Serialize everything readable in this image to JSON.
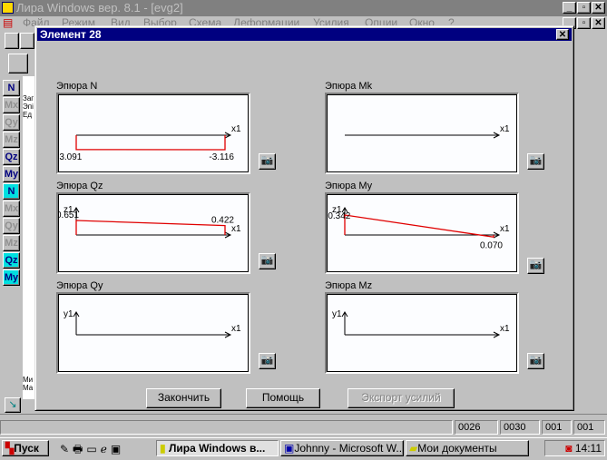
{
  "app": {
    "title": "Лира Windows  вер. 8.1 - [evg2]",
    "menu": [
      "Файл",
      "Режим",
      "Вид",
      "Выбор",
      "Схема",
      "Деформации",
      "Усилия",
      "Опции",
      "Окно",
      "?"
    ]
  },
  "side_text": {
    "top": [
      "Заг",
      "Эпі",
      "Ед"
    ],
    "bottom": [
      "Ми",
      "Ма"
    ]
  },
  "toolbar": [
    "N",
    "Mx",
    "Qy",
    "Mz",
    "Qz",
    "My",
    "N",
    "Mx",
    "Qy",
    "Mz",
    "Qz",
    "My"
  ],
  "dialog": {
    "title": "Элемент 28",
    "diagrams": [
      {
        "title": "Эпюра N",
        "axis_x": "x1",
        "values": [
          "-3.091",
          "-3.116"
        ]
      },
      {
        "title": "Эпюра Mk",
        "axis_x": "x1"
      },
      {
        "title": "Эпюра Qz",
        "axis_x": "x1",
        "axis_y": "z1",
        "values": [
          "0.651",
          "0.422"
        ]
      },
      {
        "title": "Эпюра My",
        "axis_x": "x1",
        "axis_y": "z1",
        "values": [
          "-0.342",
          "0.070"
        ]
      },
      {
        "title": "Эпюра Qy",
        "axis_x": "x1",
        "axis_y": "y1"
      },
      {
        "title": "Эпюра Mz",
        "axis_x": "x1",
        "axis_y": "y1"
      }
    ],
    "buttons": {
      "finish": "Закончить",
      "help": "Помощь",
      "export": "Экспорт усилий"
    },
    "curve_color": "#e00000"
  },
  "status": [
    "0026",
    "0030",
    "001",
    "001"
  ],
  "taskbar": {
    "start": "Пуск",
    "tasks": [
      "Лира Windows  в...",
      "Johnny - Microsoft W...",
      "Мои документы"
    ],
    "clock": "14:11"
  }
}
